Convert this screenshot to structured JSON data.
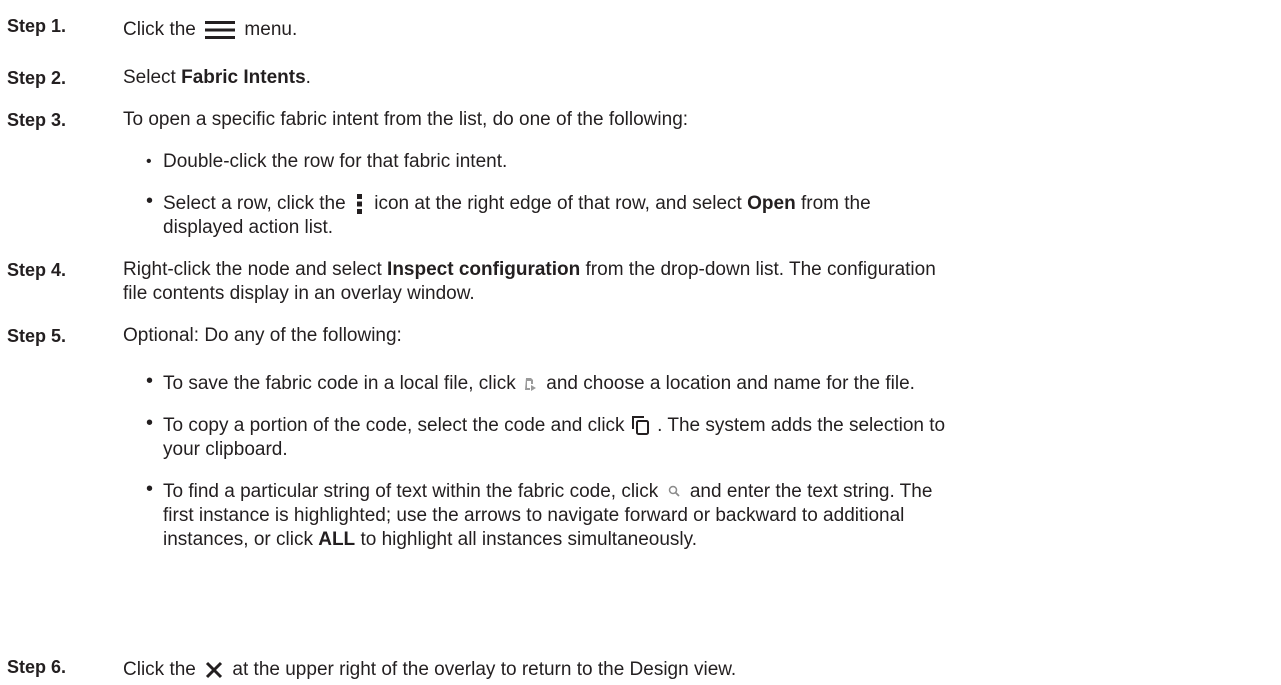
{
  "steps": [
    {
      "label": "Step 1.",
      "pre": "Click the",
      "icon": "hamburger-menu-icon",
      "post": "menu."
    },
    {
      "label": "Step 2.",
      "pre": "Select",
      "bold": "Fabric Intents",
      "post": "."
    },
    {
      "label": "Step 3.",
      "text": "To open a specific fabric intent from the list, do one of the following:",
      "bullets": [
        {
          "text": "Double-click the row for that fabric intent."
        },
        {
          "pre": "Select a row, click the",
          "icon": "kebab-menu-icon",
          "mid": "icon at the right edge of that row, and select",
          "bold": "Open",
          "post": "from the",
          "line2": "displayed action list."
        }
      ]
    },
    {
      "label": "Step 4.",
      "pre": "Right-click the node and select",
      "bold": "Inspect configuration",
      "post": "from the drop-down list. The configuration",
      "line2": "file contents display in an overlay window."
    },
    {
      "label": "Step 5.",
      "text": "Optional: Do any of the following:",
      "bullets": [
        {
          "pre": "To save the fabric code in a local file, click",
          "icon": "save-file-icon",
          "post": "and choose a location and name for the file."
        },
        {
          "pre": "To copy a portion of the code, select the code and click",
          "icon": "copy-icon",
          "post": ". The system adds the selection to",
          "line2": "your clipboard."
        },
        {
          "pre": "To find a particular string of text within the fabric code, click",
          "icon": "search-icon",
          "post": "and enter the text string. The",
          "line2": "first instance is highlighted; use the arrows to navigate forward or backward to additional",
          "line3_pre": "instances, or click",
          "line3_bold": "ALL",
          "line3_post": "to highlight all instances simultaneously."
        }
      ]
    },
    {
      "label": "Step 6.",
      "pre": "Click the",
      "icon": "close-icon",
      "post": "at the upper right of the overlay to return to the Design view."
    }
  ]
}
